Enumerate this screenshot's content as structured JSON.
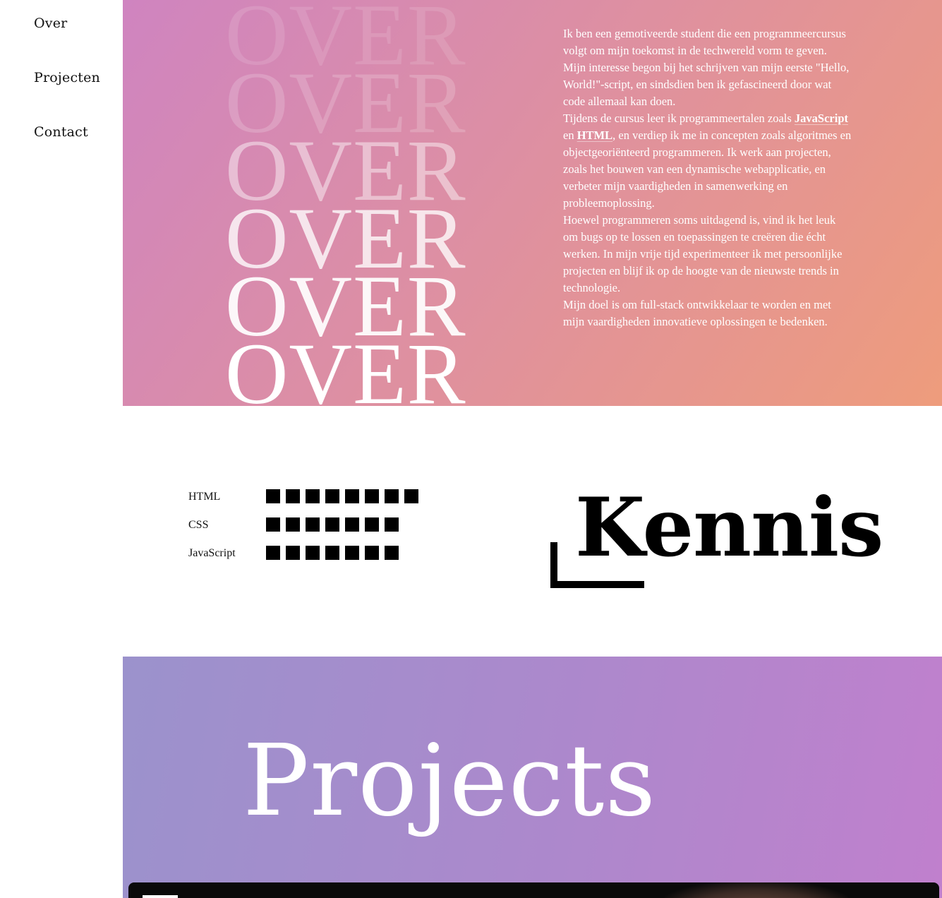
{
  "nav": {
    "items": [
      {
        "label": "Over"
      },
      {
        "label": "Projecten"
      },
      {
        "label": "Contact"
      }
    ]
  },
  "over": {
    "heading_word": "OVER",
    "paragraphs": {
      "p1": "Ik ben een gemotiveerde student die een programmeercursus volgt om mijn toekomst in de techwereld vorm te geven. Mijn interesse begon bij het schrijven van mijn eerste \"Hello, World!\"-script, en sindsdien ben ik gefascineerd door wat code allemaal kan doen.",
      "p2_before": "Tijdens de cursus leer ik programmeertalen zoals ",
      "p2_js": "JavaScript",
      "p2_and": " en ",
      "p2_html": "HTML",
      "p2_after": ", en verdiep ik me in concepten zoals algoritmes en objectgeoriënteerd programmeren. Ik werk aan projecten, zoals het bouwen van een dynamische webapplicatie, en verbeter mijn vaardigheden in samenwerking en probleemoplossing.",
      "p3": "Hoewel programmeren soms uitdagend is, vind ik het leuk om bugs op te lossen en toepassingen te creëren die écht werken. In mijn vrije tijd experimenteer ik met persoonlijke projecten en blijf ik op de hoogte van de nieuwste trends in technologie.",
      "p4": "Mijn doel is om full-stack ontwikkelaar te worden en met mijn vaardigheden innovatieve oplossingen te bedenken."
    }
  },
  "kennis": {
    "title": "Kennis",
    "skills": [
      {
        "label": "HTML",
        "level": 8
      },
      {
        "label": "CSS",
        "level": 7
      },
      {
        "label": "JavaScript",
        "level": 7
      }
    ]
  },
  "projects": {
    "title": "Projects"
  },
  "colors": {
    "over_gradient_start": "#cf84c0",
    "over_gradient_end": "#ee9c7c",
    "projects_gradient_start": "#9b92cc",
    "projects_gradient_end": "#c080cd",
    "skill_block": "#000000"
  }
}
